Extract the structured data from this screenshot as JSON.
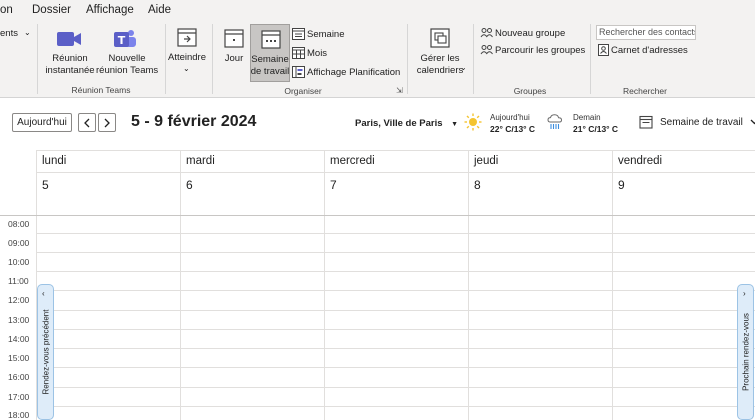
{
  "menubar": {
    "items": [
      "on",
      "Dossier",
      "Affichage",
      "Aide"
    ]
  },
  "ribbon": {
    "left_cut_label": "ents",
    "teams": {
      "instant_meeting": [
        "Réunion",
        "instantanée"
      ],
      "new_meeting": [
        "Nouvelle",
        "réunion Teams"
      ],
      "group_label": "Réunion Teams"
    },
    "goto": {
      "label": "Atteindre"
    },
    "arrange": {
      "day": "Jour",
      "work_week": [
        "Semaine",
        "de travail"
      ],
      "week": "Semaine",
      "month": "Mois",
      "schedule": "Affichage Planification",
      "group_label": "Organiser"
    },
    "manage": {
      "label": [
        "Gérer les",
        "calendriers"
      ]
    },
    "groups": {
      "new_group": "Nouveau groupe",
      "browse_groups": "Parcourir les groupes",
      "group_label": "Groupes"
    },
    "search": {
      "placeholder": "Rechercher des contacts",
      "address_book": "Carnet d'adresses",
      "group_label": "Rechercher"
    }
  },
  "calendar": {
    "today_button": "Aujourd'hui",
    "prev_icon": "chevron-left-icon",
    "next_icon": "chevron-right-icon",
    "date_range": "5 - 9 février 2024",
    "location": "Paris, Ville de Paris",
    "weather_today": {
      "label": "Aujourd'hui",
      "temp": "22° C/13° C",
      "icon": "sun-icon"
    },
    "weather_tomorrow": {
      "label": "Demain",
      "temp": "21° C/13° C",
      "icon": "rain-icon"
    },
    "view_selector": "Semaine de travail",
    "days": [
      {
        "name": "lundi",
        "num": "5"
      },
      {
        "name": "mardi",
        "num": "6"
      },
      {
        "name": "mercredi",
        "num": "7"
      },
      {
        "name": "jeudi",
        "num": "8"
      },
      {
        "name": "vendredi",
        "num": "9"
      }
    ],
    "hours": [
      "08:00",
      "09:00",
      "10:00",
      "11:00",
      "12:00",
      "13:00",
      "14:00",
      "15:00",
      "16:00",
      "17:00",
      "18:00"
    ],
    "prev_appointment": "Rendez-vous précédent",
    "next_appointment": "Prochain rendez-vous"
  },
  "colors": {
    "ribbon_bg": "#f3f2f1",
    "teams_purple": "#5b5fc7",
    "selected_btn": "#c8c6c4",
    "side_tab_bg": "#deecf9",
    "grid_line": "#e1dfdd",
    "sun": "#f4c430"
  }
}
